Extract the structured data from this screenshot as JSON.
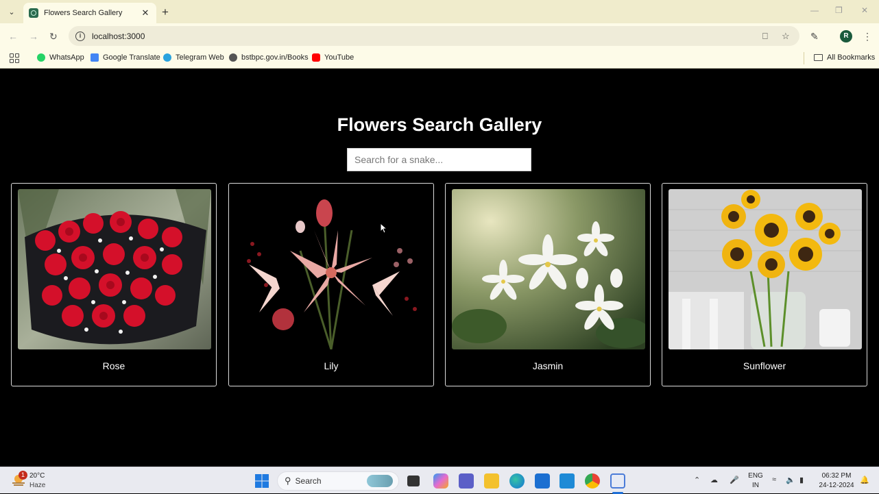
{
  "browser": {
    "tab_title": "Flowers Search Gallery",
    "url": "localhost:3000",
    "profile_initial": "R",
    "bookmarks": [
      {
        "label": "WhatsApp",
        "color": "#25d366"
      },
      {
        "label": "Google Translate",
        "color": "#4285f4"
      },
      {
        "label": "Telegram Web",
        "color": "#2aa3de"
      },
      {
        "label": "bstbpc.gov.in/Books",
        "color": "#555555"
      },
      {
        "label": "YouTube",
        "color": "#ff0000"
      }
    ],
    "all_bookmarks_label": "All Bookmarks"
  },
  "page": {
    "title": "Flowers Search Gallery",
    "search_placeholder": "Search for a snake...",
    "cards": [
      {
        "label": "Rose",
        "image": "red-roses-bouquet"
      },
      {
        "label": "Lily",
        "image": "pink-lily-bouquet"
      },
      {
        "label": "Jasmin",
        "image": "white-jasmine-flowers"
      },
      {
        "label": "Sunflower",
        "image": "sunflowers-in-vase"
      }
    ]
  },
  "taskbar": {
    "weather_badge": "1",
    "temperature": "20°C",
    "weather": "Haze",
    "search_label": "Search",
    "language_top": "ENG",
    "language_bottom": "IN",
    "time": "06:32 PM",
    "date": "24-12-2024"
  },
  "colors": {
    "page_background": "#000000",
    "chrome_background": "#fdfbe8",
    "card_border": "#dddddd"
  }
}
